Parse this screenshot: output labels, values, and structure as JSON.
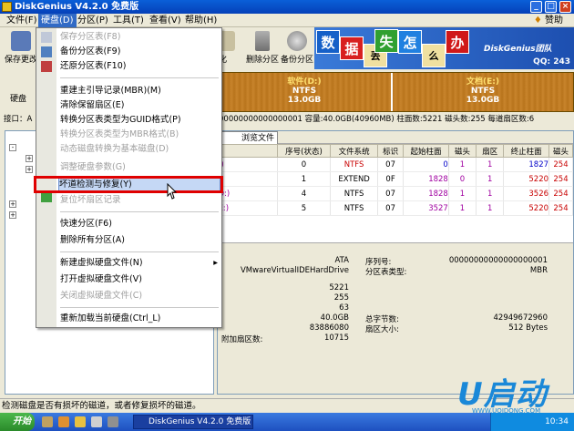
{
  "window": {
    "title": "DiskGenius V4.2.0 免费版"
  },
  "menubar": {
    "items": [
      "文件(F)",
      "硬盘(D)",
      "分区(P)",
      "工具(T)",
      "查看(V)",
      "帮助(H)"
    ],
    "donate": "赞助"
  },
  "toolbar": {
    "buttons": [
      "保存更改",
      "格式化",
      "删除分区",
      "备份分区"
    ]
  },
  "banner": {
    "tiles": [
      "数",
      "据",
      "丢",
      "失",
      "怎",
      "么",
      "办"
    ],
    "brand": "DiskGenius团队",
    "qq": "QQ: 243"
  },
  "diskmap": {
    "label_disk": "硬盘",
    "partitions": [
      {
        "name": "软件(D:)",
        "fs": "NTFS",
        "size": "13.0GB"
      },
      {
        "name": "文档(E:)",
        "fs": "NTFS",
        "size": "13.0GB"
      }
    ]
  },
  "diskinfo": {
    "left_prefix": "接口：A",
    "text": "00000000000000001 容量:40.0GB(40960MB) 柱面数:5221 磁头数:255 每道扇区数:6"
  },
  "tabs": [
    "浏览文件"
  ],
  "partition_table": {
    "headers": [
      "序号(状态)",
      "文件系统",
      "标识",
      "起始柱面",
      "磁头",
      "扇区",
      "终止柱面",
      "磁头"
    ],
    "rows": [
      {
        "name": ":)",
        "num": "0",
        "fs": "NTFS",
        "flag": "07",
        "start": "0",
        "head": "1",
        "sector": "1",
        "end": "1827",
        "ehead": "254"
      },
      {
        "name": "",
        "num": "1",
        "fs": "EXTEND",
        "flag": "0F",
        "start": "1828",
        "head": "0",
        "sector": "1",
        "end": "5220",
        "ehead": "254"
      },
      {
        "name": "D:)",
        "num": "4",
        "fs": "NTFS",
        "flag": "07",
        "start": "1828",
        "head": "1",
        "sector": "1",
        "end": "3526",
        "ehead": "254"
      },
      {
        "name": "E:)",
        "num": "5",
        "fs": "NTFS",
        "flag": "07",
        "start": "3527",
        "head": "1",
        "sector": "1",
        "end": "5220",
        "ehead": "254"
      }
    ]
  },
  "details": {
    "iface": "ATA",
    "model": "VMwareVirtualIDEHardDrive",
    "serial_label": "序列号:",
    "serial": "00000000000000000001",
    "ptstyle_label": "分区表类型:",
    "ptstyle": "MBR",
    "cyl": "5221",
    "heads": "255",
    "spt": "63",
    "cap": "40.0GB",
    "total_sectors_left": "83886080",
    "extra_label": "附加扇区数:",
    "extra": "10715",
    "total_bytes_label": "总字节数:",
    "total_bytes": "42949672960",
    "sector_size_label": "扇区大小:",
    "sector_size": "512 Bytes"
  },
  "dropdown": {
    "items": [
      {
        "label": "保存分区表(F8)",
        "disabled": true
      },
      {
        "label": "备份分区表(F9)",
        "disabled": false
      },
      {
        "label": "还原分区表(F10)",
        "disabled": false
      },
      {
        "label": "重建主引导记录(MBR)(M)",
        "disabled": false
      },
      {
        "label": "清除保留扇区(E)",
        "disabled": false
      },
      {
        "label": "转换分区表类型为GUID格式(P)",
        "disabled": false
      },
      {
        "label": "转换分区表类型为MBR格式(B)",
        "disabled": true
      },
      {
        "label": "动态磁盘转换为基本磁盘(D)",
        "disabled": true
      },
      {
        "label": "调整硬盘参数(G)",
        "disabled": true
      },
      {
        "label": "坏道检测与修复(Y)",
        "disabled": false
      },
      {
        "label": "复位坏扇区记录",
        "disabled": true
      },
      {
        "label": "快速分区(F6)",
        "disabled": false
      },
      {
        "label": "删除所有分区(A)",
        "disabled": false
      },
      {
        "label": "新建虚拟硬盘文件(N)",
        "disabled": false
      },
      {
        "label": "打开虚拟硬盘文件(V)",
        "disabled": false
      },
      {
        "label": "关闭虚拟硬盘文件(C)",
        "disabled": true
      },
      {
        "label": "重新加载当前硬盘(Ctrl_L)",
        "disabled": false
      }
    ]
  },
  "status": {
    "text": "检测磁盘是否有损坏的磁道，或者修复损坏的磁道。"
  },
  "taskbar": {
    "start": "开始",
    "app": "DiskGenius V4.2.0 免费版",
    "clock": "10:34"
  },
  "watermark": {
    "brand": "U启动",
    "url": "WWW.UQIDONG.COM"
  }
}
